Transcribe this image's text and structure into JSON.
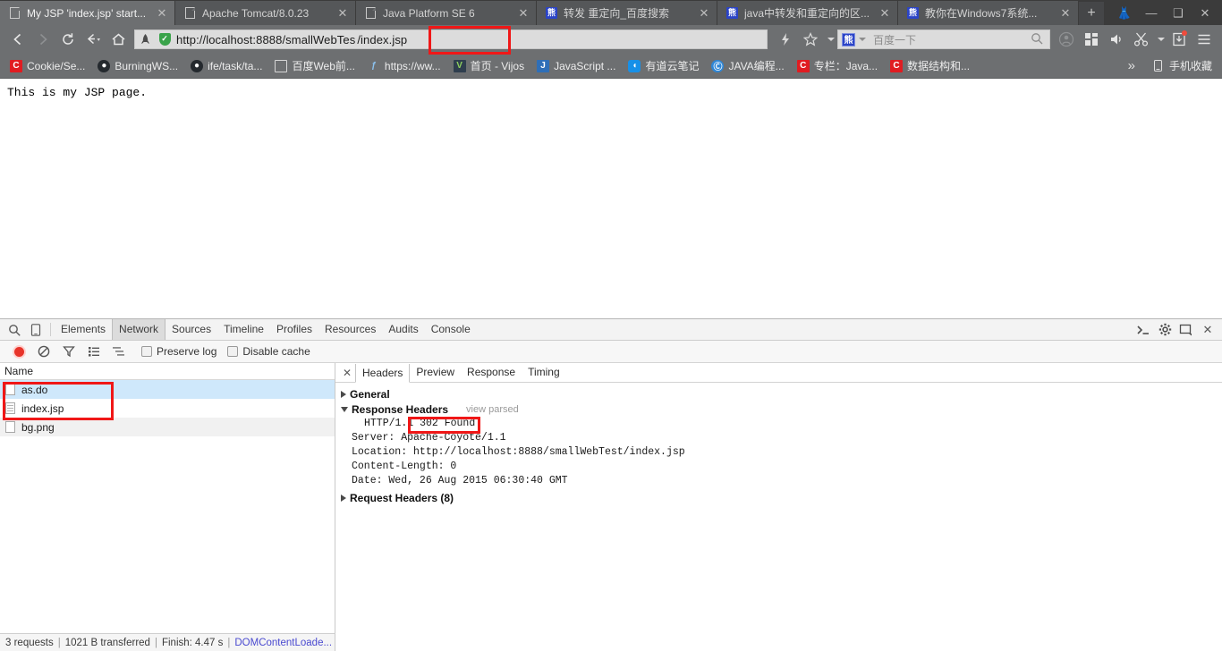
{
  "browser": {
    "tabs": [
      {
        "title": "My JSP 'index.jsp' start...",
        "favicon": "document-icon",
        "active": true
      },
      {
        "title": "Apache Tomcat/8.0.23",
        "favicon": "document-icon",
        "active": false
      },
      {
        "title": "Java Platform SE 6",
        "favicon": "document-icon",
        "active": false
      },
      {
        "title": "转发 重定向_百度搜索",
        "favicon": "baidu-icon",
        "active": false
      },
      {
        "title": "java中转发和重定向的区...",
        "favicon": "baidu-icon",
        "active": false
      },
      {
        "title": "教你在Windows7系统...",
        "favicon": "baidu-icon",
        "active": false
      }
    ],
    "new_tab_label": "+",
    "window_controls": {
      "skin": "skin-icon",
      "minimize": "—",
      "restore": "❐",
      "close": "✕"
    },
    "nav": {
      "back": "back-icon",
      "forward": "forward-icon",
      "reload": "reload-icon",
      "history": "history-icon",
      "home": "home-icon"
    },
    "url": {
      "base": "http://localhost:8888/smallWebTes",
      "highlighted": "/index.jsp",
      "security_label": "secure-shield"
    },
    "search": {
      "placeholder": "百度一下",
      "engine": "baidu"
    },
    "toolbar_icons": [
      "lightning-icon",
      "star-icon",
      "user-icon",
      "apps-icon",
      "volume-icon",
      "scissors-icon",
      "download-icon",
      "menu-icon"
    ]
  },
  "bookmarks": {
    "items": [
      {
        "label": "Cookie/Se...",
        "icon": "csdn-icon",
        "glyph": "C"
      },
      {
        "label": "BurningWS...",
        "icon": "github-icon",
        "glyph": "●"
      },
      {
        "label": "ife/task/ta...",
        "icon": "github-icon",
        "glyph": "●"
      },
      {
        "label": "百度Web前...",
        "icon": "document-icon",
        "glyph": ""
      },
      {
        "label": "https://ww...",
        "icon": "link-icon",
        "glyph": "ƒ"
      },
      {
        "label": "首页 - Vijos",
        "icon": "vijos-icon",
        "glyph": "V"
      },
      {
        "label": "JavaScript ...",
        "icon": "js-icon",
        "glyph": "J"
      },
      {
        "label": "有道云笔记",
        "icon": "youdao-icon",
        "glyph": "◖"
      },
      {
        "label": "JAVA编程...",
        "icon": "java-icon",
        "glyph": "ⓘ"
      },
      {
        "label": "专栏：Java...",
        "icon": "csdn-icon",
        "glyph": "C"
      },
      {
        "label": "数据结构和...",
        "icon": "csdn-icon",
        "glyph": "C"
      }
    ],
    "overflow_label": "»",
    "mobile_bookmarks_label": "手机收藏"
  },
  "page": {
    "content": "This is my JSP page."
  },
  "devtools": {
    "panels": [
      "Elements",
      "Network",
      "Sources",
      "Timeline",
      "Profiles",
      "Resources",
      "Audits",
      "Console"
    ],
    "active_panel": "Network",
    "left_icons": [
      "inspect-icon",
      "device-icon"
    ],
    "right_icons": [
      "console-drawer-icon",
      "gear-icon",
      "dock-icon",
      "close-icon"
    ],
    "network_toolbar": {
      "record": "record-icon",
      "clear": "clear-icon",
      "filter": "filter-icon",
      "list_view": "list-view-icon",
      "waterfall": "waterfall-icon",
      "preserve_log_label": "Preserve log",
      "preserve_log_checked": false,
      "disable_cache_label": "Disable cache",
      "disable_cache_checked": false
    },
    "request_list": {
      "column_header": "Name",
      "rows": [
        {
          "name": "as.do",
          "selected": true,
          "icon": "blank-doc-icon"
        },
        {
          "name": "index.jsp",
          "selected": false,
          "icon": "lines-doc-icon"
        },
        {
          "name": "bg.png",
          "selected": false,
          "icon": "blank-doc-icon"
        }
      ]
    },
    "detail": {
      "tabs": [
        "Headers",
        "Preview",
        "Response",
        "Timing"
      ],
      "active_tab": "Headers",
      "close_label": "✕",
      "sections": {
        "general": {
          "title": "General",
          "expanded": false
        },
        "response_headers": {
          "title": "Response Headers",
          "expanded": true,
          "view_parsed_label": "view parsed",
          "status_prefix": "HTTP/1.1",
          "status_value": "302 Found",
          "lines": [
            "Server: Apache-Coyote/1.1",
            "Location: http://localhost:8888/smallWebTest/index.jsp",
            "Content-Length: 0",
            "Date: Wed, 26 Aug 2015 06:30:40 GMT"
          ]
        },
        "request_headers": {
          "title": "Request Headers (8)",
          "expanded": false
        }
      }
    },
    "status_bar": {
      "requests": "3 requests",
      "transferred": "1021 B transferred",
      "finish": "Finish: 4.47 s",
      "dom_content_loaded": "DOMContentLoade...",
      "separator": "|"
    }
  },
  "annotations": {
    "accent_color": "#f01717",
    "boxes": [
      {
        "name": "url-suffix-highlight"
      },
      {
        "name": "request-rows-highlight"
      },
      {
        "name": "status-code-highlight"
      }
    ]
  }
}
